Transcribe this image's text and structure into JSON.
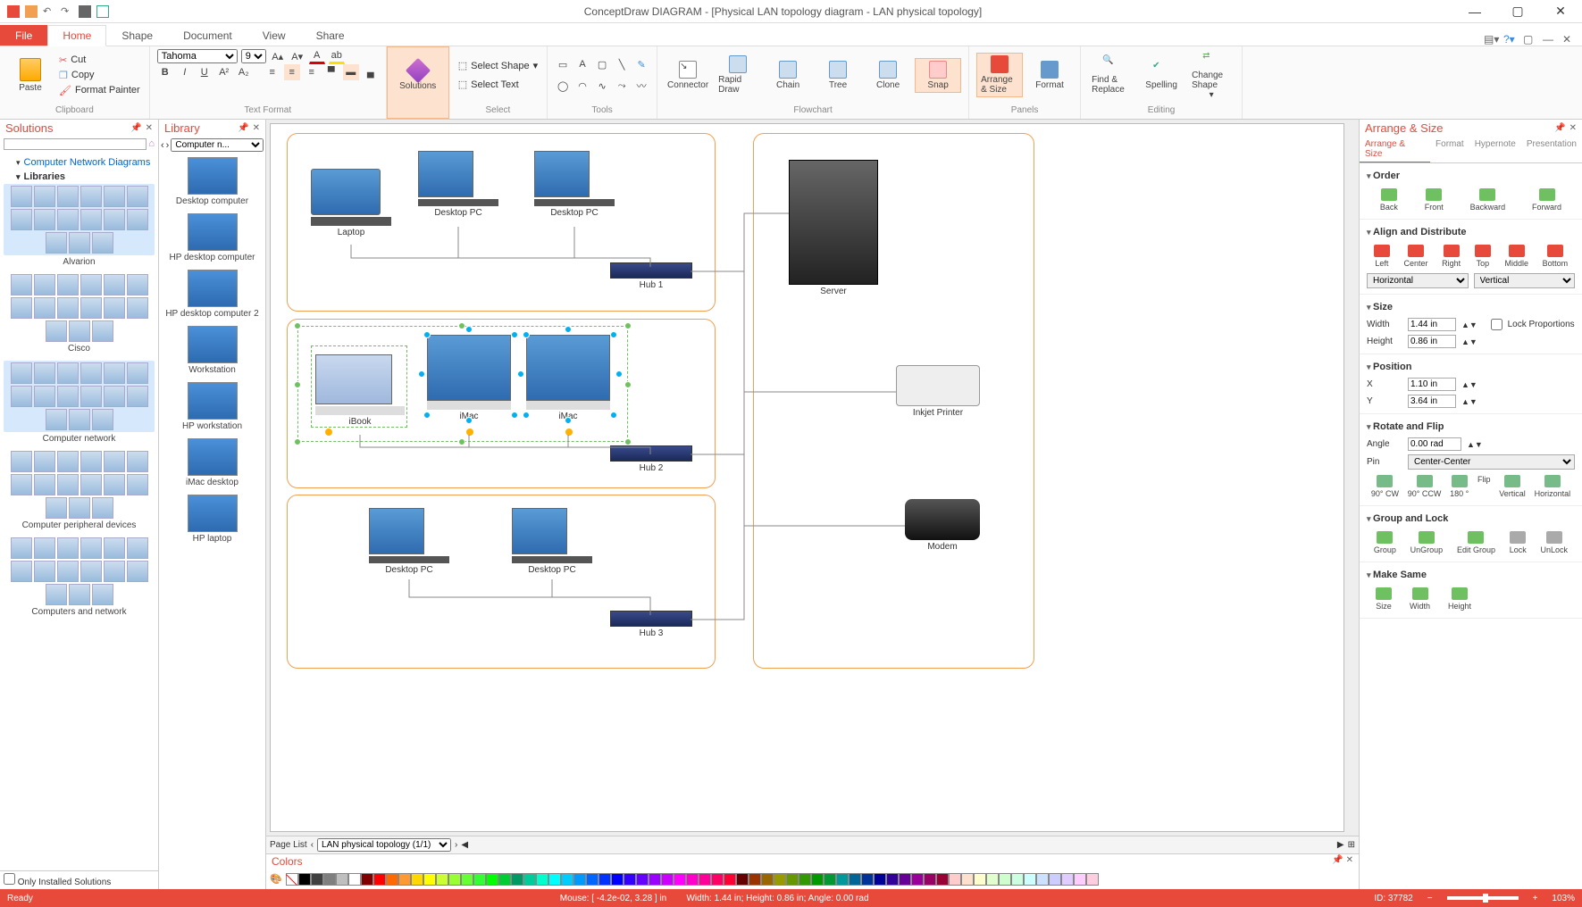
{
  "app": {
    "title": "ConceptDraw DIAGRAM - [Physical LAN topology diagram - LAN physical topology]"
  },
  "tabs": {
    "file": "File",
    "home": "Home",
    "shape": "Shape",
    "document": "Document",
    "view": "View",
    "share": "Share"
  },
  "ribbon": {
    "clipboard": {
      "label": "Clipboard",
      "paste": "Paste",
      "cut": "Cut",
      "copy": "Copy",
      "format_painter": "Format Painter"
    },
    "text_format": {
      "label": "Text Format",
      "font": "Tahoma",
      "size": "9"
    },
    "solutions": {
      "label": "Solutions"
    },
    "select": {
      "label": "Select",
      "select_shape": "Select Shape",
      "select_text": "Select Text"
    },
    "tools": {
      "label": "Tools"
    },
    "flowchart": {
      "label": "Flowchart",
      "connector": "Connector",
      "rapid_draw": "Rapid Draw",
      "chain": "Chain",
      "tree": "Tree",
      "clone": "Clone",
      "snap": "Snap"
    },
    "panels": {
      "label": "Panels",
      "arrange_size": "Arrange & Size",
      "format": "Format"
    },
    "editing": {
      "label": "Editing",
      "find_replace": "Find & Replace",
      "spelling": "Spelling",
      "change_shape": "Change Shape"
    }
  },
  "solutions_panel": {
    "title": "Solutions",
    "root": "Computer Network Diagrams",
    "libraries_label": "Libraries",
    "only_installed": "Only Installed Solutions",
    "groups": [
      "Alvarion",
      "Cisco",
      "Computer network",
      "Computer peripheral devices",
      "Computers and network"
    ]
  },
  "library_panel": {
    "title": "Library",
    "selector": "Computer n...",
    "items": [
      "Desktop computer",
      "HP desktop computer",
      "HP desktop computer 2",
      "Workstation",
      "HP workstation",
      "iMac desktop",
      "HP laptop"
    ]
  },
  "canvas": {
    "devices": {
      "laptop": "Laptop",
      "desktop_pc": "Desktop PC",
      "hub1": "Hub 1",
      "hub2": "Hub 2",
      "hub3": "Hub 3",
      "ibook": "iBook",
      "imac": "iMac",
      "server": "Server",
      "inkjet": "Inkjet Printer",
      "modem": "Modem"
    }
  },
  "pagelist": {
    "label": "Page List",
    "page": "LAN physical topology (1/1)"
  },
  "colors_panel": {
    "title": "Colors"
  },
  "arrange": {
    "title": "Arrange & Size",
    "tabs": {
      "arrange": "Arrange & Size",
      "format": "Format",
      "hypernote": "Hypernote",
      "presentation": "Presentation"
    },
    "order": {
      "head": "Order",
      "back": "Back",
      "front": "Front",
      "backward": "Backward",
      "forward": "Forward"
    },
    "align": {
      "head": "Align and Distribute",
      "left": "Left",
      "center": "Center",
      "right": "Right",
      "top": "Top",
      "middle": "Middle",
      "bottom": "Bottom",
      "horizontal": "Horizontal",
      "vertical": "Vertical"
    },
    "size": {
      "head": "Size",
      "width_label": "Width",
      "width": "1.44 in",
      "height_label": "Height",
      "height": "0.86 in",
      "lock": "Lock Proportions"
    },
    "position": {
      "head": "Position",
      "x_label": "X",
      "x": "1.10 in",
      "y_label": "Y",
      "y": "3.64 in"
    },
    "rotate": {
      "head": "Rotate and Flip",
      "angle_label": "Angle",
      "angle": "0.00 rad",
      "pin_label": "Pin",
      "pin": "Center-Center",
      "cw": "90° CW",
      "ccw": "90° CCW",
      "r180": "180 °",
      "flip": "Flip",
      "vertical": "Vertical",
      "horizontal": "Horizontal"
    },
    "group": {
      "head": "Group and Lock",
      "group": "Group",
      "ungroup": "UnGroup",
      "edit": "Edit Group",
      "lock": "Lock",
      "unlock": "UnLock"
    },
    "same": {
      "head": "Make Same",
      "size": "Size",
      "width": "Width",
      "height": "Height"
    }
  },
  "status": {
    "ready": "Ready",
    "mouse": "Mouse: [ -4.2e-02, 3.28 ] in",
    "dims": "Width: 1.44 in;  Height: 0.86 in;  Angle: 0.00 rad",
    "id": "ID: 37782",
    "zoom": "103%"
  },
  "color_swatches": [
    "#000000",
    "#404040",
    "#7f7f7f",
    "#bfbfbf",
    "#ffffff",
    "#800000",
    "#ff0000",
    "#ff6a00",
    "#ff9933",
    "#ffd800",
    "#ffff00",
    "#ccff33",
    "#99ff33",
    "#66ff33",
    "#33ff33",
    "#00ff00",
    "#00cc33",
    "#009966",
    "#00cc99",
    "#00ffcc",
    "#00ffff",
    "#00ccff",
    "#0099ff",
    "#0066ff",
    "#0033ff",
    "#0000ff",
    "#3300ff",
    "#6600ff",
    "#9900ff",
    "#cc00ff",
    "#ff00ff",
    "#ff00cc",
    "#ff0099",
    "#ff0066",
    "#ff0033",
    "#660000",
    "#993300",
    "#996600",
    "#999900",
    "#669900",
    "#339900",
    "#009900",
    "#009933",
    "#009999",
    "#006699",
    "#003399",
    "#000099",
    "#330099",
    "#660099",
    "#990099",
    "#990066",
    "#990033",
    "#ffcccc",
    "#ffe0cc",
    "#ffffcc",
    "#e0ffcc",
    "#ccffcc",
    "#ccffe0",
    "#ccffff",
    "#cce0ff",
    "#ccccff",
    "#e0ccff",
    "#ffccff",
    "#ffcce0"
  ]
}
